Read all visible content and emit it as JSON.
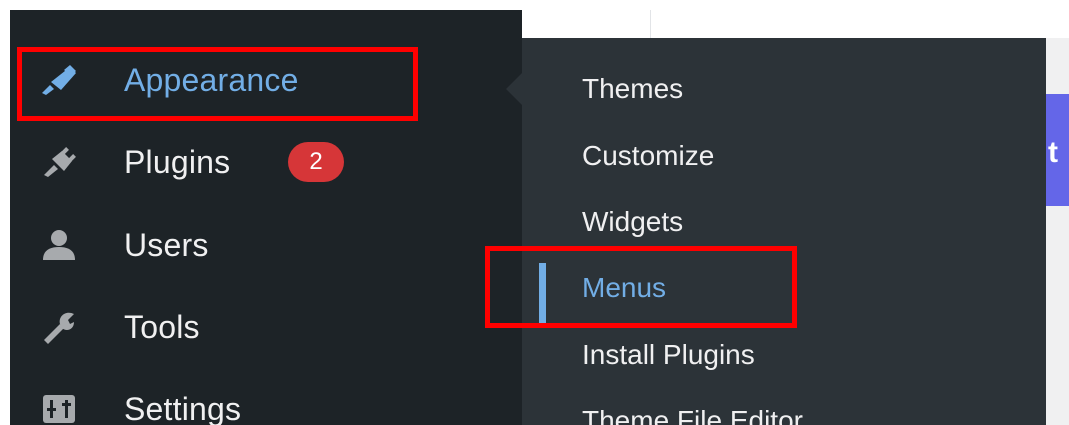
{
  "sidebar": {
    "items": [
      {
        "label": "Appearance",
        "icon": "paintbrush-icon",
        "active": true
      },
      {
        "label": "Plugins",
        "icon": "plugin-icon",
        "badge": "2"
      },
      {
        "label": "Users",
        "icon": "user-icon"
      },
      {
        "label": "Tools",
        "icon": "wrench-icon"
      },
      {
        "label": "Settings",
        "icon": "settings-sliders-icon"
      }
    ]
  },
  "submenu": {
    "items": [
      {
        "label": "Themes"
      },
      {
        "label": "Customize"
      },
      {
        "label": "Widgets"
      },
      {
        "label": "Menus",
        "current": true
      },
      {
        "label": "Install Plugins"
      },
      {
        "label": "Theme File Editor"
      }
    ]
  },
  "content": {
    "partial_text": "t"
  },
  "colors": {
    "sidebar_bg": "#1d2327",
    "flyout_bg": "#2c3338",
    "active_text": "#72aee6",
    "badge_bg": "#d63638",
    "highlight": "#ff0000",
    "accent_strip": "#6466e8"
  }
}
